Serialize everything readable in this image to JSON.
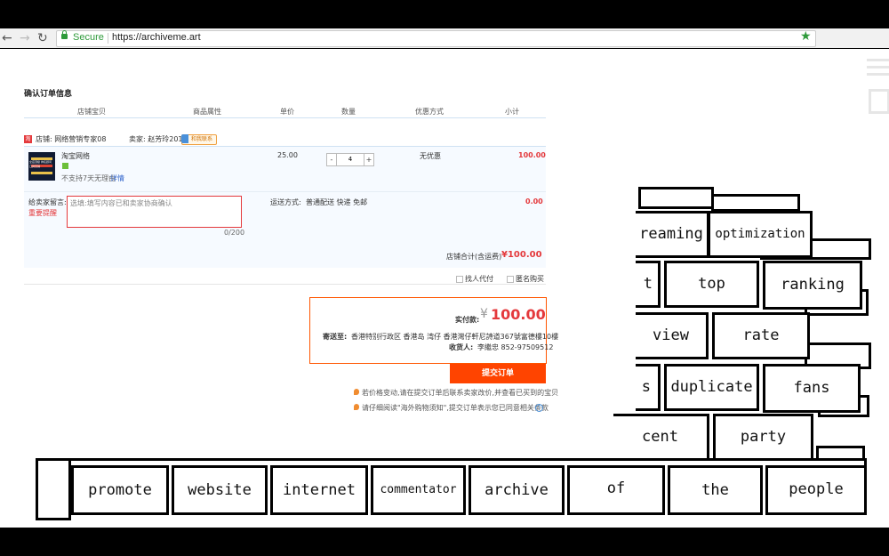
{
  "browser": {
    "secure_label": "Secure",
    "url": "https://archiveme.art"
  },
  "order": {
    "title": "确认订单信息",
    "columns": [
      "店铺宝贝",
      "商品属性",
      "单价",
      "数量",
      "优惠方式",
      "小计"
    ],
    "shop_label": "店铺: 网络营销专家08",
    "seller_label": "卖家: 赵芳玲2014",
    "contact_label": "和我联系",
    "item": {
      "name": "淘宝网络",
      "thumb_text": "全店顶级 排名顾问 口碑营销",
      "no_return": "不支持7天无理由",
      "details_link": "详情",
      "unit_price": "25.00",
      "quantity": "4",
      "minus": "-",
      "plus": "+",
      "discount": "无优惠",
      "subtotal": "100.00"
    },
    "message": {
      "label": "给卖家留言:",
      "reminder": "重要提醒",
      "placeholder": "选填:填写内容已和卖家协商确认",
      "counter": "0/200",
      "shipping_label": "运送方式:",
      "shipping_value": "普通配送 快递 免邮",
      "shipping_cost": "0.00"
    },
    "shop_total_label": "店铺合计(含运费)",
    "shop_total_value": "¥100.00",
    "options": {
      "pay_for_me": "找人代付",
      "anonymous": "匿名购买"
    },
    "payment": {
      "label": "实付款:",
      "currency": "¥",
      "amount": "100.00",
      "ship_to_label": "寄送至:",
      "address": "香港特别行政区 香港岛 湾仔   香港灣仔軒尼詩道367號富德樓10樓",
      "recipient_label": "收货人:",
      "recipient": "李繼忠  852-97509512"
    },
    "submit_label": "提交订单",
    "notice1": "若价格变动,请在提交订单后联系卖家改价,并查看已买到的宝贝",
    "notice2": "请仔细阅读\"海外购物须知\",提交订单表示您已同意相关条款",
    "help": "?"
  },
  "bricks": {
    "row1": [
      "reaming",
      "optimization"
    ],
    "row2": [
      "t",
      "top",
      "ranking"
    ],
    "row3": [
      "view",
      "rate"
    ],
    "row4": [
      "s",
      "duplicate",
      "fans"
    ],
    "row5": [
      "cent",
      "party"
    ],
    "row6": [
      "promote",
      "website",
      "internet",
      "commentator",
      "archive",
      "of",
      "the",
      "people"
    ]
  }
}
